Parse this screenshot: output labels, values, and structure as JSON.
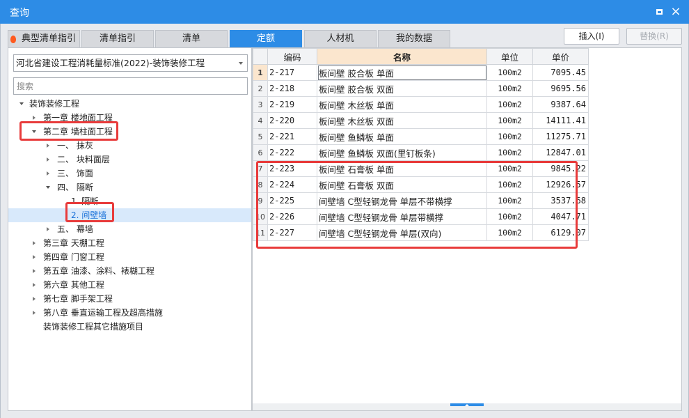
{
  "window": {
    "title": "查询"
  },
  "tabs": [
    {
      "label": "典型清单指引",
      "icon": "fire-icon"
    },
    {
      "label": "清单指引"
    },
    {
      "label": "清单"
    },
    {
      "label": "定额",
      "active": true
    },
    {
      "label": "人材机"
    },
    {
      "label": "我的数据"
    }
  ],
  "actions": {
    "insert_label": "插入(I)",
    "replace_label": "替换(R)"
  },
  "left": {
    "standard_select": "河北省建设工程消耗量标准(2022)-装饰装修工程",
    "search_placeholder": "搜索",
    "tree": [
      {
        "label": "装饰装修工程",
        "level": 0,
        "state": "expanded"
      },
      {
        "label": "第一章 楼地面工程",
        "level": 1,
        "state": "collapsed"
      },
      {
        "label": "第二章 墙柱面工程",
        "level": 1,
        "state": "expanded"
      },
      {
        "label": "一、 抹灰",
        "level": 2,
        "state": "collapsed"
      },
      {
        "label": "二、 块料面层",
        "level": 2,
        "state": "collapsed"
      },
      {
        "label": "三、 饰面",
        "level": 2,
        "state": "collapsed"
      },
      {
        "label": "四、 隔断",
        "level": 2,
        "state": "expanded"
      },
      {
        "label": "1. 隔断",
        "level": 3,
        "state": "leaf"
      },
      {
        "label": "2. 间壁墙",
        "level": 3,
        "state": "leaf",
        "selected": true
      },
      {
        "label": "五、 幕墙",
        "level": 2,
        "state": "collapsed"
      },
      {
        "label": "第三章 天棚工程",
        "level": 1,
        "state": "collapsed"
      },
      {
        "label": "第四章 门窗工程",
        "level": 1,
        "state": "collapsed"
      },
      {
        "label": "第五章 油漆、涂料、裱糊工程",
        "level": 1,
        "state": "collapsed"
      },
      {
        "label": "第六章 其他工程",
        "level": 1,
        "state": "collapsed"
      },
      {
        "label": "第七章 脚手架工程",
        "level": 1,
        "state": "collapsed"
      },
      {
        "label": "第八章 垂直运输工程及超高措施",
        "level": 1,
        "state": "collapsed"
      },
      {
        "label": "装饰装修工程其它措施项目",
        "level": 1,
        "state": "leaf"
      }
    ]
  },
  "grid": {
    "columns": [
      "编码",
      "名称",
      "单位",
      "单价"
    ],
    "rows": [
      {
        "num": "1",
        "code": "2-217",
        "name": "板间壁 胶合板 单面",
        "unit": "100m2",
        "price": "7095.45"
      },
      {
        "num": "2",
        "code": "2-218",
        "name": "板间壁 胶合板 双面",
        "unit": "100m2",
        "price": "9695.56"
      },
      {
        "num": "3",
        "code": "2-219",
        "name": "板间壁 木丝板 单面",
        "unit": "100m2",
        "price": "9387.64"
      },
      {
        "num": "4",
        "code": "2-220",
        "name": "板间壁 木丝板 双面",
        "unit": "100m2",
        "price": "14111.41"
      },
      {
        "num": "5",
        "code": "2-221",
        "name": "板间壁 鱼鳞板 单面",
        "unit": "100m2",
        "price": "11275.71"
      },
      {
        "num": "6",
        "code": "2-222",
        "name": "板间壁 鱼鳞板 双面(里钉板条)",
        "unit": "100m2",
        "price": "12847.01"
      },
      {
        "num": "7",
        "code": "2-223",
        "name": "板间壁 石膏板 单面",
        "unit": "100m2",
        "price": "9845.22"
      },
      {
        "num": "8",
        "code": "2-224",
        "name": "板间壁 石膏板 双面",
        "unit": "100m2",
        "price": "12926.57"
      },
      {
        "num": "9",
        "code": "2-225",
        "name": "间壁墙 C型轻钢龙骨 单层不带横撑",
        "unit": "100m2",
        "price": "3537.68"
      },
      {
        "num": "10",
        "code": "2-226",
        "name": "间壁墙 C型轻钢龙骨 单层带横撑",
        "unit": "100m2",
        "price": "4047.71"
      },
      {
        "num": "11",
        "code": "2-227",
        "name": "间壁墙 C型轻钢龙骨 单层(双向)",
        "unit": "100m2",
        "price": "6129.07"
      }
    ]
  },
  "colors": {
    "accent": "#2d8ce6",
    "highlight_box": "#e83b3b",
    "header_highlight": "#fbe6ce"
  }
}
